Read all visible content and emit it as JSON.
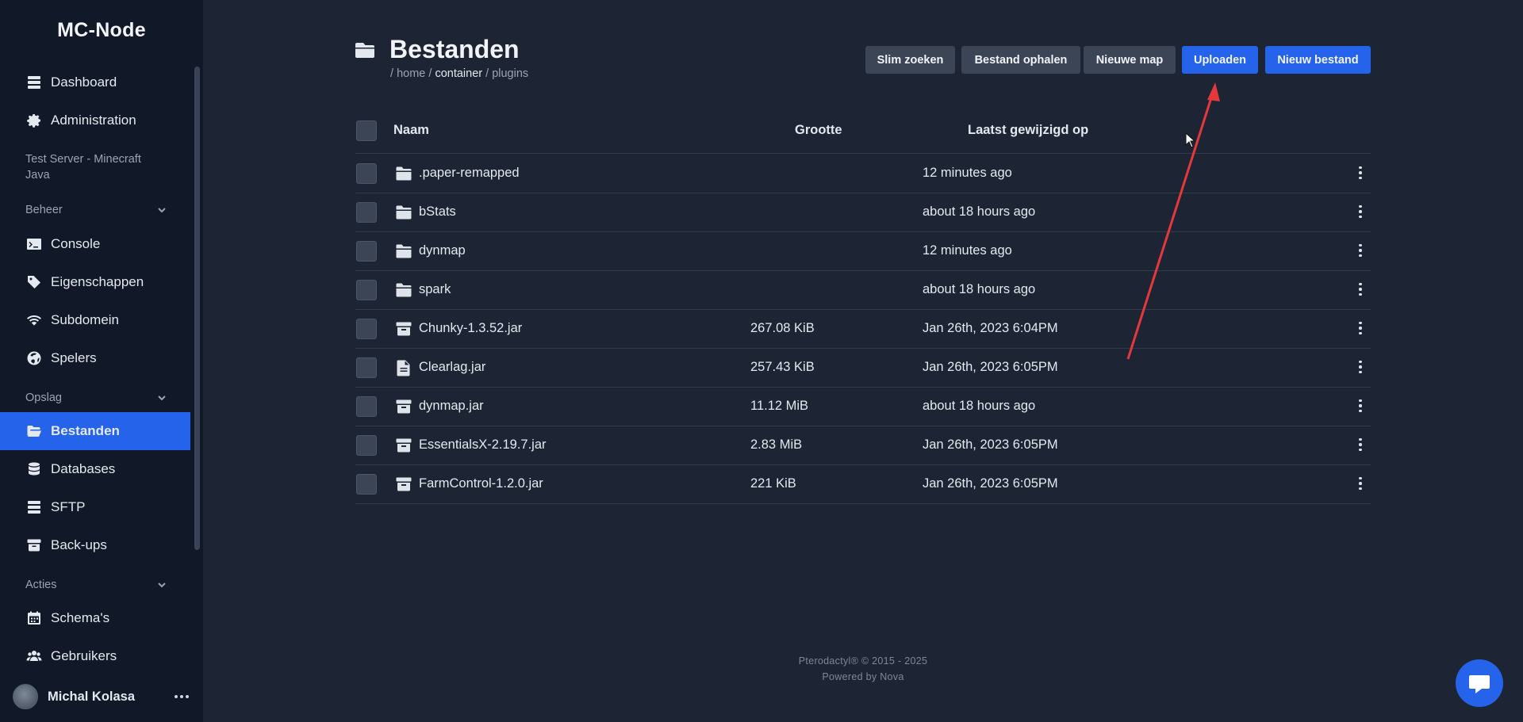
{
  "sidebar": {
    "brand": "MC-Node",
    "top_items": [
      {
        "label": "Dashboard",
        "icon": "server-icon"
      },
      {
        "label": "Administration",
        "icon": "gear-icon"
      }
    ],
    "server_name": "Test Server - Minecraft Java",
    "sections": [
      {
        "label": "Beheer",
        "items": [
          {
            "label": "Console",
            "icon": "terminal-icon"
          },
          {
            "label": "Eigenschappen",
            "icon": "tag-icon"
          },
          {
            "label": "Subdomein",
            "icon": "wifi-icon"
          },
          {
            "label": "Spelers",
            "icon": "globe-icon"
          }
        ]
      },
      {
        "label": "Opslag",
        "items": [
          {
            "label": "Bestanden",
            "icon": "folder-open-icon",
            "active": true
          },
          {
            "label": "Databases",
            "icon": "database-icon"
          },
          {
            "label": "SFTP",
            "icon": "server-icon"
          },
          {
            "label": "Back-ups",
            "icon": "archive-icon"
          }
        ]
      },
      {
        "label": "Acties",
        "items": [
          {
            "label": "Schema's",
            "icon": "calendar-icon"
          },
          {
            "label": "Gebruikers",
            "icon": "users-icon"
          }
        ]
      }
    ],
    "user_name": "Michal Kolasa"
  },
  "page": {
    "title": "Bestanden",
    "breadcrumb": {
      "sep1": "/ ",
      "home": "home",
      "sep2": " / ",
      "container": "container",
      "sep3": " / ",
      "plugins": "plugins"
    }
  },
  "toolbar": {
    "smart_search": "Slim zoeken",
    "fetch_file": "Bestand ophalen",
    "new_folder": "Nieuwe map",
    "upload": "Uploaden",
    "new_file": "Nieuw bestand"
  },
  "table": {
    "columns": {
      "name": "Naam",
      "size": "Grootte",
      "modified": "Laatst gewijzigd op"
    },
    "rows": [
      {
        "name": ".paper-remapped",
        "size": "",
        "modified": "12 minutes ago",
        "type": "folder"
      },
      {
        "name": "bStats",
        "size": "",
        "modified": "about 18 hours ago",
        "type": "folder"
      },
      {
        "name": "dynmap",
        "size": "",
        "modified": "12 minutes ago",
        "type": "folder"
      },
      {
        "name": "spark",
        "size": "",
        "modified": "about 18 hours ago",
        "type": "folder"
      },
      {
        "name": "Chunky-1.3.52.jar",
        "size": "267.08 KiB",
        "modified": "Jan 26th, 2023 6:04PM",
        "type": "archive"
      },
      {
        "name": "Clearlag.jar",
        "size": "257.43 KiB",
        "modified": "Jan 26th, 2023 6:05PM",
        "type": "file"
      },
      {
        "name": "dynmap.jar",
        "size": "11.12 MiB",
        "modified": "about 18 hours ago",
        "type": "archive"
      },
      {
        "name": "EssentialsX-2.19.7.jar",
        "size": "2.83 MiB",
        "modified": "Jan 26th, 2023 6:05PM",
        "type": "archive"
      },
      {
        "name": "FarmControl-1.2.0.jar",
        "size": "221 KiB",
        "modified": "Jan 26th, 2023 6:05PM",
        "type": "archive"
      }
    ]
  },
  "footer": {
    "copyright": "Pterodactyl® © 2015 - 2025",
    "powered": "Powered by Nova"
  },
  "colors": {
    "accent": "#2563eb",
    "sidebar_bg": "#111827",
    "main_bg": "#1d2535",
    "annotation_arrow": "#e5383b"
  }
}
